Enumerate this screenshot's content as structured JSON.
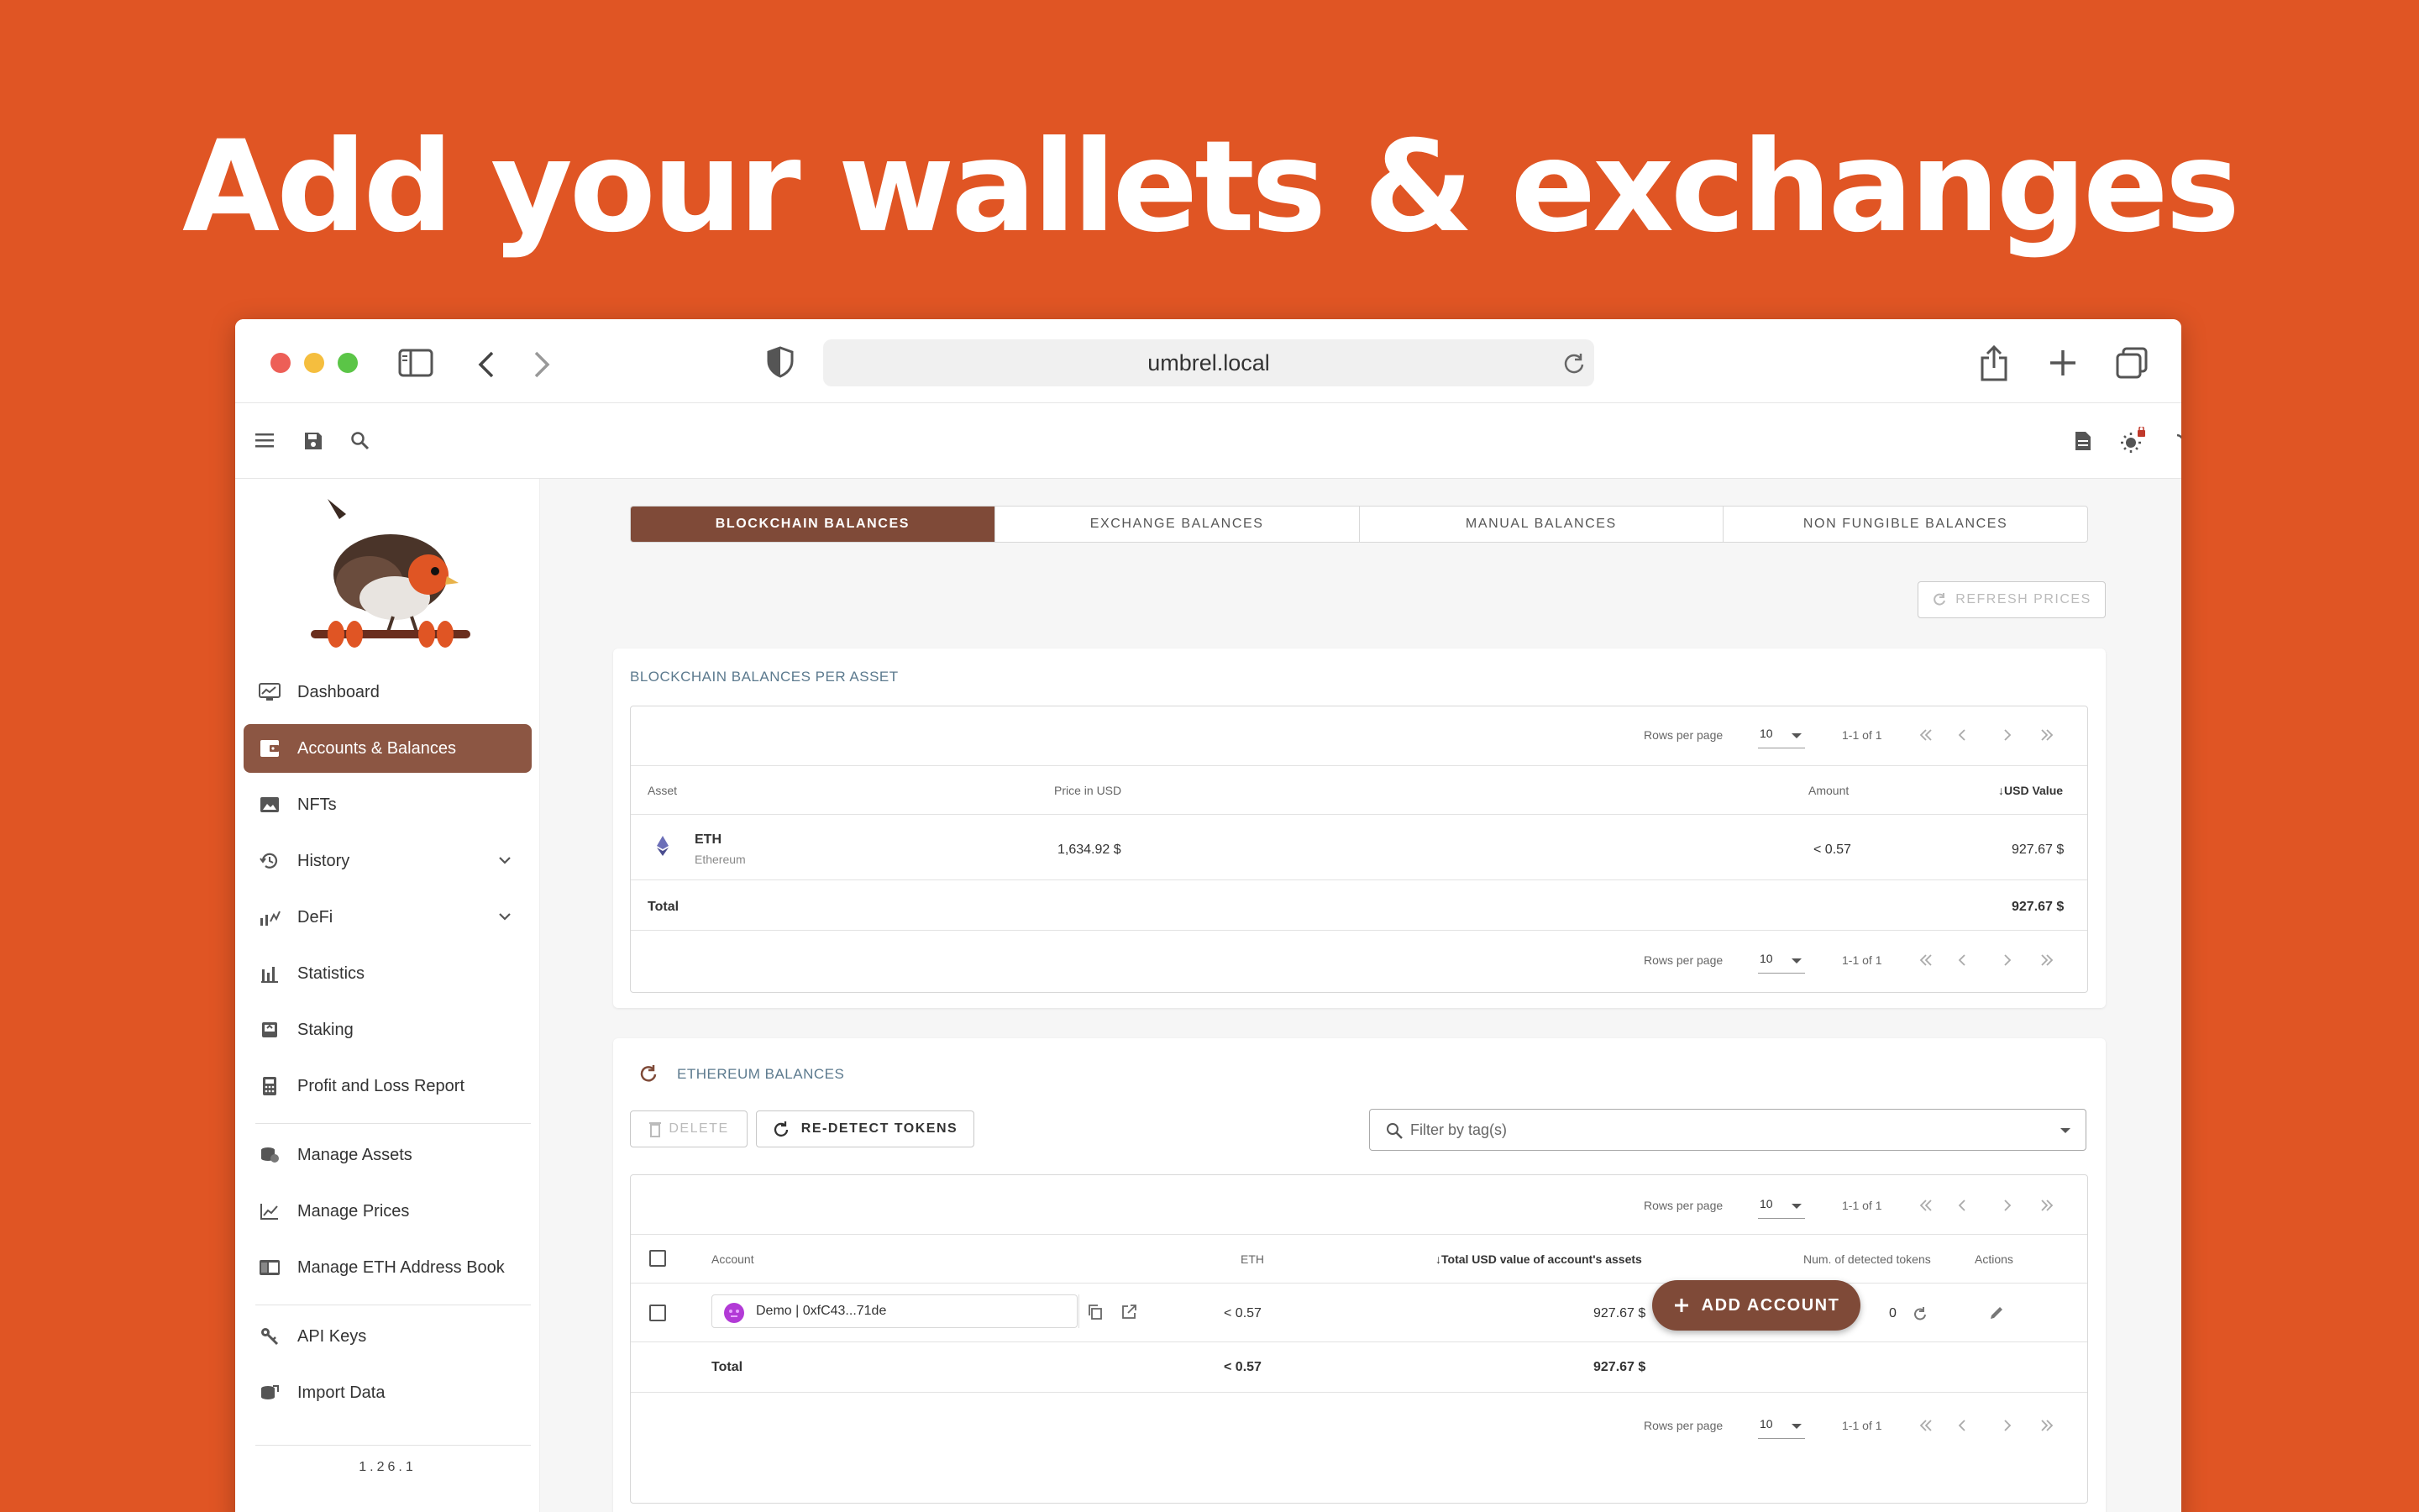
{
  "headline": "Add your wallets & exchanges",
  "browser": {
    "url": "umbrel.local"
  },
  "colors": {
    "background": "#E05524",
    "accent": "#7F4A38",
    "active_nav": "#8C5643"
  },
  "appbar_icons": [
    "menu-icon",
    "save-icon",
    "search-icon",
    "notes-icon",
    "theme-icon",
    "lock-icon",
    "loading-icon",
    "currency-icon",
    "privacy-eye-icon",
    "account-icon",
    "help-icon"
  ],
  "sidebar": {
    "items": [
      {
        "label": "Dashboard",
        "icon": "dashboard-icon"
      },
      {
        "label": "Accounts & Balances",
        "icon": "wallet-icon"
      },
      {
        "label": "NFTs",
        "icon": "image-icon"
      },
      {
        "label": "History",
        "icon": "history-icon"
      },
      {
        "label": "DeFi",
        "icon": "defi-icon"
      },
      {
        "label": "Statistics",
        "icon": "bar-chart-icon"
      },
      {
        "label": "Staking",
        "icon": "staking-icon"
      },
      {
        "label": "Profit and Loss Report",
        "icon": "calculator-icon"
      },
      {
        "label": "Manage Assets",
        "icon": "coins-icon"
      },
      {
        "label": "Manage Prices",
        "icon": "line-chart-icon"
      },
      {
        "label": "Manage ETH Address Book",
        "icon": "address-book-icon"
      },
      {
        "label": "API Keys",
        "icon": "key-icon"
      },
      {
        "label": "Import Data",
        "icon": "import-icon"
      }
    ],
    "version": "1.26.1"
  },
  "tabs": [
    "BLOCKCHAIN BALANCES",
    "EXCHANGE BALANCES",
    "MANUAL BALANCES",
    "NON FUNGIBLE BALANCES"
  ],
  "refresh_prices": "REFRESH PRICES",
  "per_asset": {
    "title": "BLOCKCHAIN BALANCES PER ASSET",
    "pager": {
      "rows_per_page_label": "Rows per page",
      "rows": "10",
      "range": "1-1 of 1"
    },
    "columns": {
      "asset": "Asset",
      "price": "Price in USD",
      "amount": "Amount",
      "usd_value": "USD Value"
    },
    "row": {
      "symbol": "ETH",
      "name": "Ethereum",
      "price": "1,634.92 $",
      "amount": "< 0.57",
      "usd_value": "927.67 $"
    },
    "total_label": "Total",
    "total_value": "927.67 $"
  },
  "ethereum": {
    "title": "ETHEREUM BALANCES",
    "delete": "DELETE",
    "redetect": "RE-DETECT TOKENS",
    "filter_placeholder": "Filter by tag(s)",
    "pager": {
      "rows_per_page_label": "Rows per page",
      "rows": "10",
      "range": "1-1 of 1"
    },
    "columns": {
      "account": "Account",
      "eth": "ETH",
      "total_usd": "Total USD value of account's assets",
      "detected": "Num. of detected tokens",
      "actions": "Actions"
    },
    "row": {
      "account": "Demo | 0xfC43...71de",
      "eth": "< 0.57",
      "total_usd": "927.67 $",
      "detected": "0"
    },
    "total_label": "Total",
    "total_eth": "< 0.57",
    "total_usd": "927.67 $"
  },
  "add_account": "ADD ACCOUNT"
}
